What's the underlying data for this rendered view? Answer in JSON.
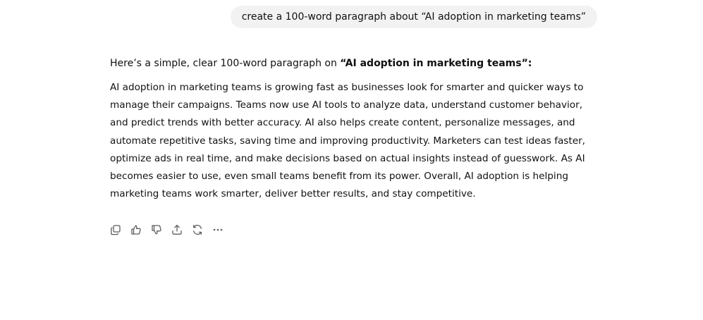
{
  "conversation": {
    "user_message": "create a 100-word paragraph about “AI adoption in marketing teams”",
    "assistant": {
      "intro_prefix": "Here’s a simple, clear 100-word paragraph on ",
      "intro_bold": "“AI adoption in marketing teams”:",
      "paragraph": "AI adoption in marketing teams is growing fast as businesses look for smarter and quicker ways to manage their campaigns. Teams now use AI tools to analyze data, understand customer behavior, and predict trends with better accuracy. AI also helps create content, personalize messages, and automate repetitive tasks, saving time and improving productivity. Marketers can test ideas faster, optimize ads in real time, and make decisions based on actual insights instead of guesswork. As AI becomes easier to use, even small teams benefit from its power. Overall, AI adoption is helping marketing teams work smarter, deliver better results, and stay competitive."
    }
  },
  "actions": [
    {
      "icon": "copy-icon"
    },
    {
      "icon": "thumbs-up-icon"
    },
    {
      "icon": "thumbs-down-icon"
    },
    {
      "icon": "share-icon"
    },
    {
      "icon": "regenerate-icon"
    },
    {
      "icon": "more-icon"
    }
  ],
  "colors": {
    "bubble_bg": "#f2f2f2",
    "text": "#111111",
    "icon": "#5d5d5d"
  }
}
